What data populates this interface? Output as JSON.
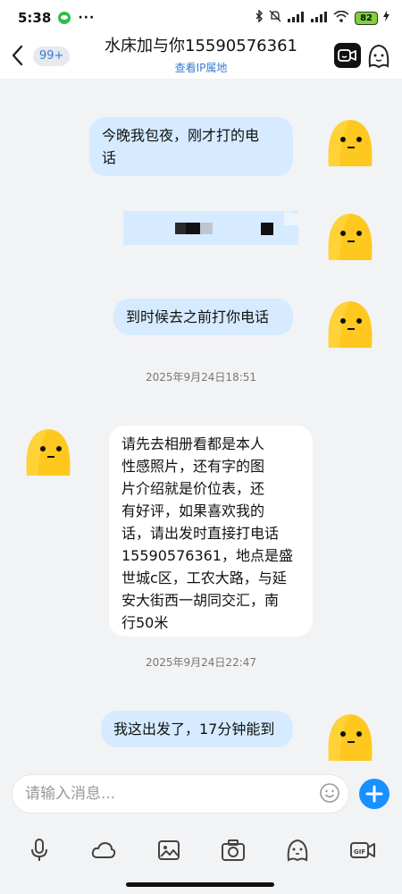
{
  "status_bar": {
    "time": "5:38",
    "dots": "···",
    "battery": "82"
  },
  "header": {
    "back_badge": "99+",
    "title": "水床加与你15590576361",
    "subtitle": "查看IP属地"
  },
  "messages": [
    {
      "direction": "out",
      "lines": [
        "今晚我包夜，刚才打的电",
        "话"
      ]
    },
    {
      "direction": "out",
      "type": "redacted"
    },
    {
      "direction": "out",
      "lines": [
        "到时候去之前打你电话"
      ]
    },
    {
      "type": "timestamp",
      "text": "2025年9月24日18:51"
    },
    {
      "direction": "in",
      "lines": [
        "请先去相册看都是本人",
        "性感照片，还有字的图",
        "片介绍就是价位表，还",
        "有好评，如果喜欢我的",
        "话，请出发时直接打电话",
        "15590576361，地点是盛",
        "世城c区，工农大路，与延",
        "安大街西一胡同交汇，南",
        "行50米"
      ]
    },
    {
      "type": "timestamp",
      "text": "2025年9月24日22:47"
    },
    {
      "direction": "out",
      "lines": [
        "我这出发了，17分钟能到"
      ]
    }
  ],
  "input": {
    "placeholder": "请输入消息..."
  },
  "colors": {
    "accent": "#1890ff",
    "bubble_out": "#d6ebff",
    "bubble_in": "#ffffff",
    "avatar": "#ffc81e"
  }
}
